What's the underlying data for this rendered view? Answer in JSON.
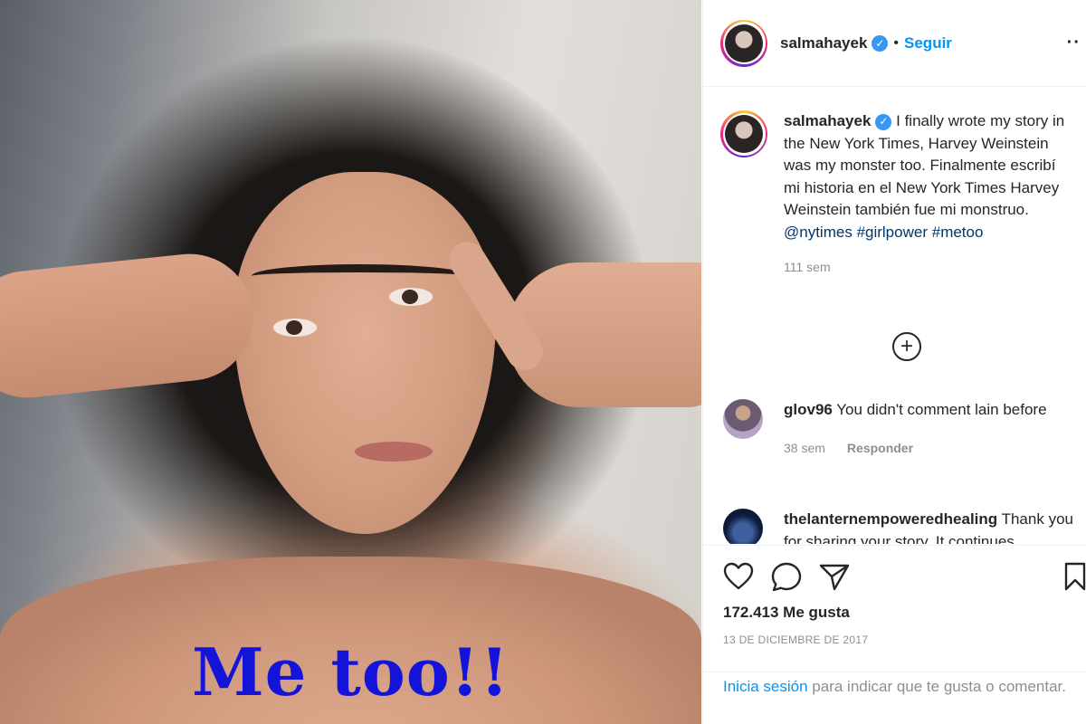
{
  "photo": {
    "meme_text": "Me too!!"
  },
  "header": {
    "username": "salmahayek",
    "separator": "•",
    "follow_label": "Seguir",
    "more_label": "··"
  },
  "caption": {
    "username": "salmahayek",
    "text_main": "I finally wrote my story in the New York Times, Harvey Weinstein was my monster too. Finalmente escribí mi historia en el New York Times Harvey Weinstein también fue mi monstruo.",
    "tag_mention": "@nytimes",
    "tag_1": "#girlpower",
    "tag_2": "#metoo",
    "age": "111 sem"
  },
  "load_more_icon": "plus-circle-icon",
  "comments": [
    {
      "username": "glov96",
      "text": "You didn't comment lain before",
      "age": "38 sem",
      "reply_label": "Responder"
    },
    {
      "username": "thelanternempoweredhealing",
      "text": "Thank you for sharing your story. It continues"
    }
  ],
  "actions": {
    "icons": [
      "heart-icon",
      "comment-icon",
      "share-icon",
      "bookmark-icon"
    ],
    "likes": "172.413 Me gusta",
    "date": "13 DE DICIEMBRE DE 2017"
  },
  "login_prompt": {
    "link": "Inicia sesión",
    "text": "para indicar que te gusta o comentar."
  },
  "colors": {
    "link_blue": "#0095f6",
    "verified_blue": "#3897f0",
    "meme_blue": "#1414d8",
    "muted": "#8e8e8e"
  }
}
